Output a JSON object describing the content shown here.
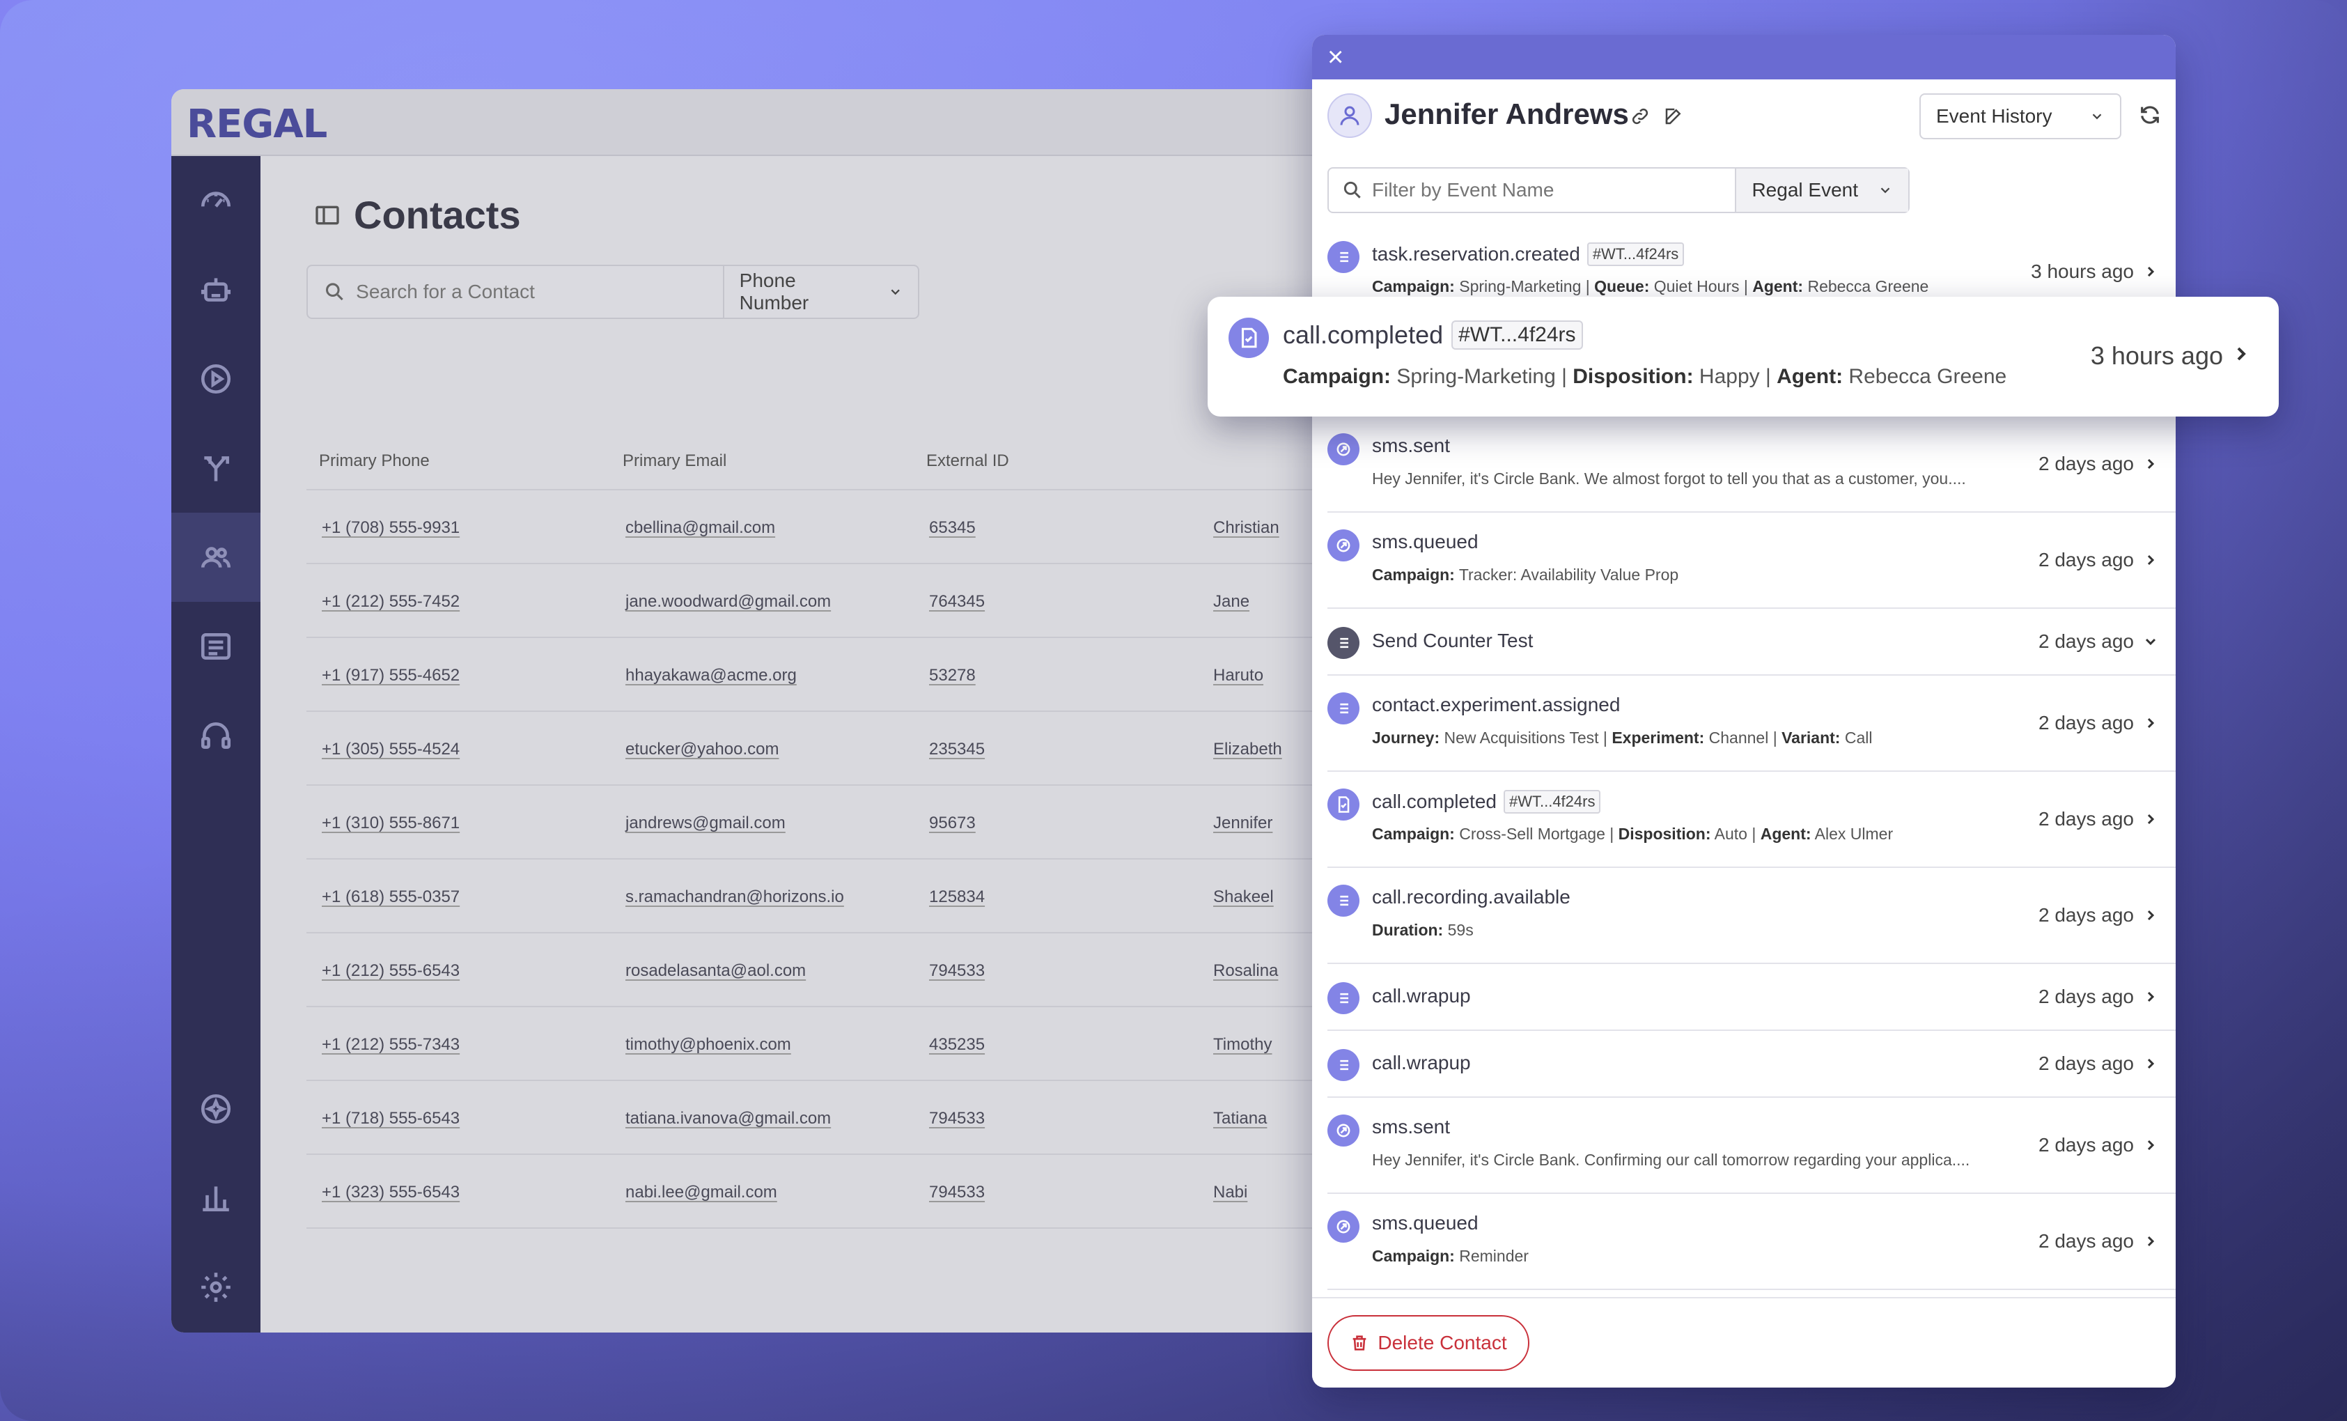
{
  "app": {
    "logo": "REGAL",
    "page_title": "Contacts",
    "search": {
      "placeholder": "Search for a Contact",
      "type_label": "Phone Number"
    },
    "columns": [
      "Primary Phone",
      "Primary Email",
      "External ID",
      ""
    ],
    "rows": [
      {
        "phone": "+1 (708) 555-9931",
        "email": "cbellina@gmail.com",
        "external_id": "65345",
        "first_name": "Christian"
      },
      {
        "phone": "+1 (212) 555-7452",
        "email": "jane.woodward@gmail.com",
        "external_id": "764345",
        "first_name": "Jane"
      },
      {
        "phone": "+1 (917) 555-4652",
        "email": "hhayakawa@acme.org",
        "external_id": "53278",
        "first_name": "Haruto"
      },
      {
        "phone": "+1 (305) 555-4524",
        "email": "etucker@yahoo.com",
        "external_id": "235345",
        "first_name": "Elizabeth"
      },
      {
        "phone": "+1 (310) 555-8671",
        "email": "jandrews@gmail.com",
        "external_id": "95673",
        "first_name": "Jennifer"
      },
      {
        "phone": "+1 (618) 555-0357",
        "email": "s.ramachandran@horizons.io",
        "external_id": "125834",
        "first_name": "Shakeel"
      },
      {
        "phone": "+1 (212) 555-6543",
        "email": "rosadelasanta@aol.com",
        "external_id": "794533",
        "first_name": "Rosalina"
      },
      {
        "phone": "+1 (212) 555-7343",
        "email": "timothy@phoenix.com",
        "external_id": "435235",
        "first_name": "Timothy"
      },
      {
        "phone": "+1 (718) 555-6543",
        "email": "tatiana.ivanova@gmail.com",
        "external_id": "794533",
        "first_name": "Tatiana"
      },
      {
        "phone": "+1 (323) 555-6543",
        "email": "nabi.lee@gmail.com",
        "external_id": "794533",
        "first_name": "Nabi"
      }
    ]
  },
  "drawer": {
    "close_label": "×",
    "contact_name": "Jennifer Andrews",
    "view_select": "Event History",
    "filter": {
      "placeholder": "Filter by Event Name",
      "type_label": "Regal Event"
    },
    "delete_label": "Delete Contact",
    "events": [
      {
        "name": "task.reservation.created",
        "tag": "#WT...4f24rs",
        "detail": [
          [
            "Campaign:",
            " Spring-Marketing | "
          ],
          [
            "Queue:",
            " Quiet Hours | "
          ],
          [
            "Agent:",
            " Rebecca Greene"
          ]
        ],
        "time": "3 hours ago",
        "icon": "list",
        "chev": "right"
      },
      {
        "name": "call.completed",
        "tag": "#WT...4f24rs",
        "detail": [
          [
            "Campaign:",
            " Spring-Marketing | "
          ],
          [
            "Disposition:",
            " Happy | "
          ],
          [
            "Agent:",
            " Rebecca Greene"
          ]
        ],
        "time": "3 hours ago",
        "icon": "phone-doc",
        "chev": "right"
      },
      {
        "name": "sms.sent",
        "tag": "",
        "text": "Hey Jennifer, it's Circle Bank. We almost forgot to tell you that as a customer, you....",
        "time": "2 days ago",
        "icon": "sms",
        "chev": "right"
      },
      {
        "name": "sms.queued",
        "tag": "",
        "detail": [
          [
            "Campaign:",
            " Tracker: Availability Value Prop"
          ]
        ],
        "time": "2 days ago",
        "icon": "sms",
        "chev": "right"
      },
      {
        "name": "Send Counter Test",
        "tag": "",
        "time": "2 days ago",
        "icon": "list-dark",
        "chev": "down"
      },
      {
        "name": "contact.experiment.assigned",
        "tag": "",
        "detail": [
          [
            "Journey:",
            " New Acquisitions Test | "
          ],
          [
            "Experiment:",
            " Channel | "
          ],
          [
            "Variant:",
            " Call"
          ]
        ],
        "time": "2 days ago",
        "icon": "list",
        "chev": "right"
      },
      {
        "name": "call.completed",
        "tag": "#WT...4f24rs",
        "detail": [
          [
            "Campaign:",
            " Cross-Sell Mortgage | "
          ],
          [
            "Disposition:",
            " Auto | "
          ],
          [
            "Agent:",
            " Alex Ulmer"
          ]
        ],
        "time": "2 days ago",
        "icon": "phone-doc",
        "chev": "right"
      },
      {
        "name": "call.recording.available",
        "tag": "",
        "detail": [
          [
            "Duration:",
            " 59s"
          ]
        ],
        "time": "2 days ago",
        "icon": "list",
        "chev": "right"
      },
      {
        "name": "call.wrapup",
        "tag": "",
        "time": "2 days ago",
        "icon": "list",
        "chev": "right"
      },
      {
        "name": "call.wrapup",
        "tag": "",
        "time": "2 days ago",
        "icon": "list",
        "chev": "right"
      },
      {
        "name": "sms.sent",
        "tag": "",
        "text": "Hey Jennifer, it's Circle Bank. Confirming our call tomorrow regarding your applica....",
        "time": "2 days ago",
        "icon": "sms",
        "chev": "right"
      },
      {
        "name": "sms.queued",
        "tag": "",
        "detail": [
          [
            "Campaign:",
            " Reminder"
          ]
        ],
        "time": "2 days ago",
        "icon": "sms",
        "chev": "right"
      }
    ]
  },
  "highlight_card": {
    "name": "call.completed",
    "tag": "#WT...4f24rs",
    "detail": [
      [
        "Campaign:",
        " Spring-Marketing | "
      ],
      [
        "Disposition:",
        " Happy | "
      ],
      [
        "Agent:",
        " Rebecca Greene"
      ]
    ],
    "time": "3 hours ago"
  },
  "colors": {
    "accent": "#6a6bd2",
    "event_icon": "#8384e6",
    "danger": "#c9303a",
    "nav_bg": "#2f2f55"
  }
}
